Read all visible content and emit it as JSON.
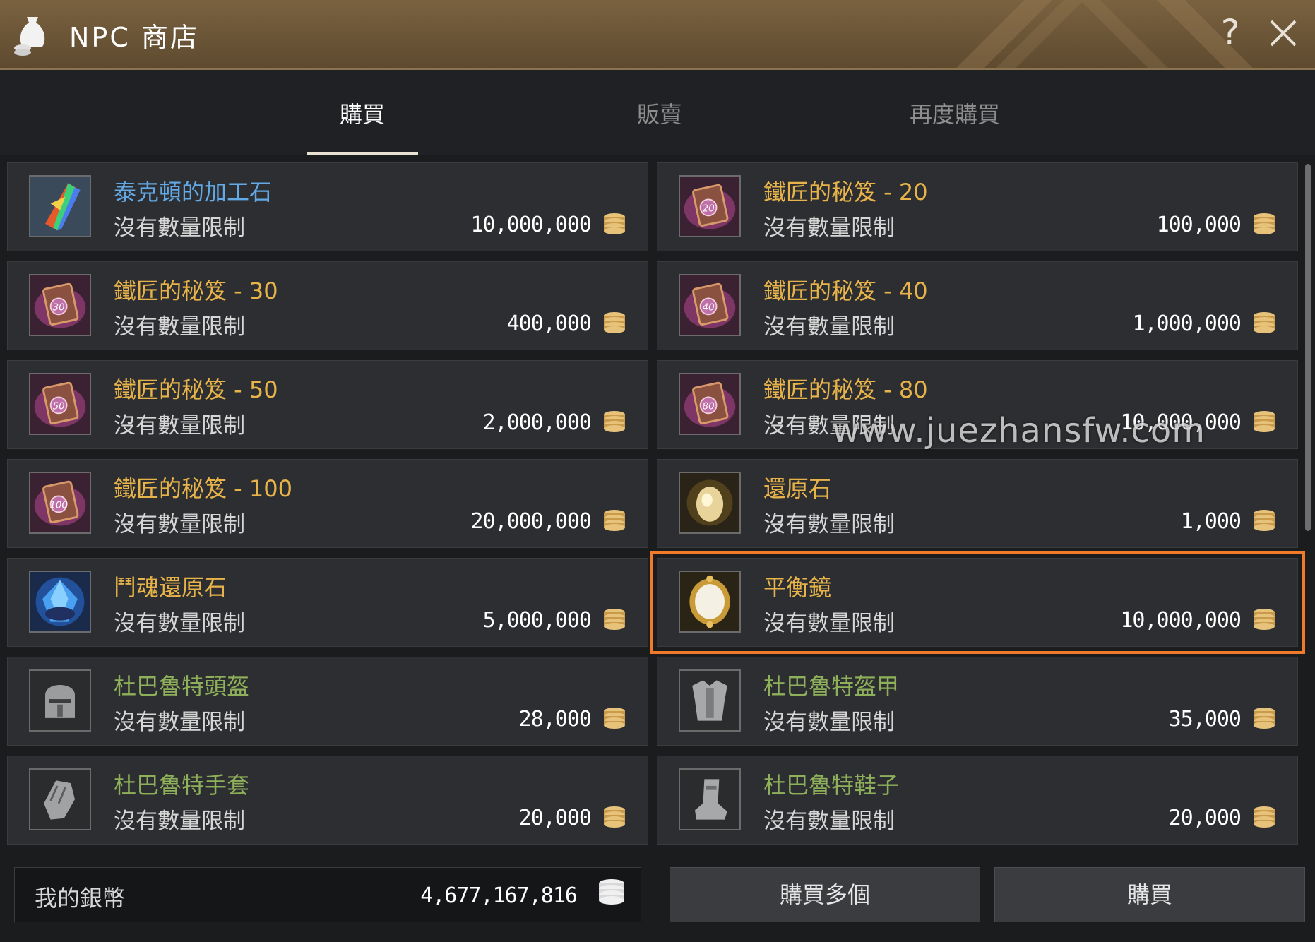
{
  "window": {
    "title": "NPC 商店"
  },
  "tabs": [
    {
      "label": "購買"
    },
    {
      "label": "販賣"
    },
    {
      "label": "再度購買"
    }
  ],
  "items": [
    {
      "name": "泰克頓的加工石",
      "limit": "沒有數量限制",
      "price": "10,000,000",
      "name_color": "blue",
      "icon": "gem-crystal-icon"
    },
    {
      "name": "鐵匠的秘笈 - 20",
      "limit": "沒有數量限制",
      "price": "100,000",
      "name_color": "gold",
      "icon": "book-20-icon",
      "badge": "20"
    },
    {
      "name": "鐵匠的秘笈 - 30",
      "limit": "沒有數量限制",
      "price": "400,000",
      "name_color": "gold",
      "icon": "book-30-icon",
      "badge": "30"
    },
    {
      "name": "鐵匠的秘笈 - 40",
      "limit": "沒有數量限制",
      "price": "1,000,000",
      "name_color": "gold",
      "icon": "book-40-icon",
      "badge": "40"
    },
    {
      "name": "鐵匠的秘笈 - 50",
      "limit": "沒有數量限制",
      "price": "2,000,000",
      "name_color": "gold",
      "icon": "book-50-icon",
      "badge": "50"
    },
    {
      "name": "鐵匠的秘笈 - 80",
      "limit": "沒有數量限制",
      "price": "10,000,000",
      "name_color": "gold",
      "icon": "book-80-icon",
      "badge": "80"
    },
    {
      "name": "鐵匠的秘笈 - 100",
      "limit": "沒有數量限制",
      "price": "20,000,000",
      "name_color": "gold",
      "icon": "book-100-icon",
      "badge": "100"
    },
    {
      "name": "還原石",
      "limit": "沒有數量限制",
      "price": "1,000",
      "name_color": "gold",
      "icon": "restore-stone-icon"
    },
    {
      "name": "鬥魂還原石",
      "limit": "沒有數量限制",
      "price": "5,000,000",
      "name_color": "gold",
      "icon": "blue-crystal-icon"
    },
    {
      "name": "平衡鏡",
      "limit": "沒有數量限制",
      "price": "10,000,000",
      "name_color": "gold",
      "icon": "mirror-icon",
      "selected": true
    },
    {
      "name": "杜巴魯特頭盔",
      "limit": "沒有數量限制",
      "price": "28,000",
      "name_color": "green",
      "icon": "helmet-icon"
    },
    {
      "name": "杜巴魯特盔甲",
      "limit": "沒有數量限制",
      "price": "35,000",
      "name_color": "green",
      "icon": "armor-icon"
    },
    {
      "name": "杜巴魯特手套",
      "limit": "沒有數量限制",
      "price": "20,000",
      "name_color": "green",
      "icon": "gloves-icon"
    },
    {
      "name": "杜巴魯特鞋子",
      "limit": "沒有數量限制",
      "price": "20,000",
      "name_color": "green",
      "icon": "boots-icon"
    }
  ],
  "footer": {
    "silver_label": "我的銀幣",
    "silver_value": "4,677,167,816",
    "buy_multiple": "購買多個",
    "buy": "購買"
  },
  "watermark": "www.juezhansfw.com",
  "colors": {
    "selected_outline": "#f07a2a",
    "blue_name": "#62a9e6",
    "gold_name": "#e8b449",
    "green_name": "#8fb05a"
  }
}
